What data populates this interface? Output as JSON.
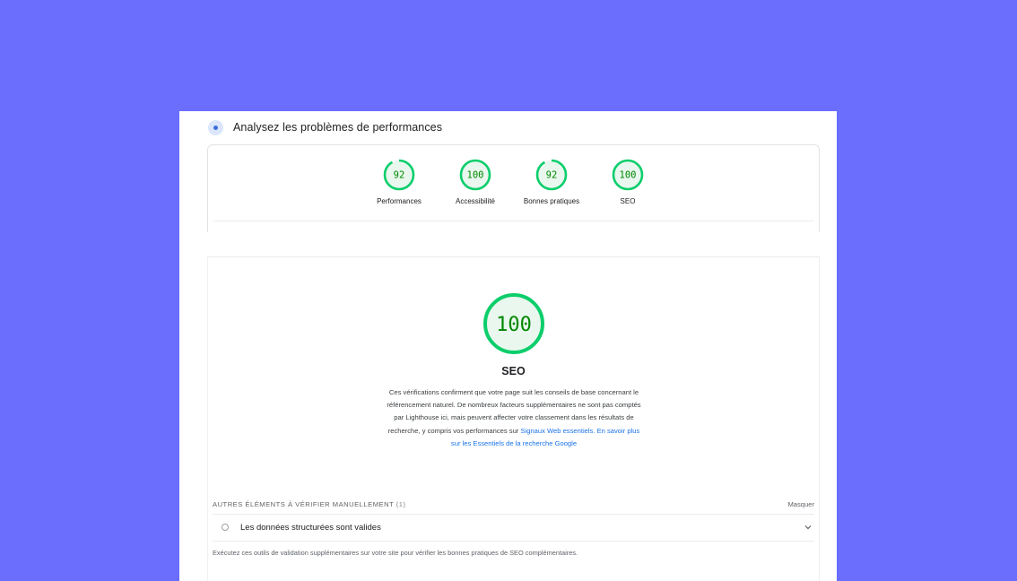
{
  "header": {
    "title": "Analysez les problèmes de performances"
  },
  "summary": {
    "gauges": [
      {
        "score": "92",
        "label": "Performances",
        "fraction": 0.92
      },
      {
        "score": "100",
        "label": "Accessibilité",
        "fraction": 1.0
      },
      {
        "score": "92",
        "label": "Bonnes pratiques",
        "fraction": 0.92
      },
      {
        "score": "100",
        "label": "SEO",
        "fraction": 1.0
      }
    ]
  },
  "detail": {
    "score": "100",
    "fraction": 1.0,
    "title": "SEO",
    "description": "Ces vérifications confirment que votre page suit les conseils de base concernant le référencement naturel. De nombreux facteurs supplémentaires ne sont pas comptés par Lighthouse ici, mais peuvent affecter votre classement dans les résultats de recherche, y compris vos performances sur ",
    "link1": "Signaux Web essentiels",
    "link_sep": ". ",
    "link2": "En savoir plus sur les Essentiels de la recherche Google"
  },
  "manual": {
    "title": "Autres éléments à vérifier manuellement",
    "count": "(1)",
    "hide_label": "Masquer",
    "audit": "Les données structurées sont valides",
    "note": "Exécutez ces outils de validation supplémentaires sur votre site pour vérifier les bonnes pratiques de SEO complémentaires."
  },
  "colors": {
    "background": "#6b6dfd",
    "pass": "#0cce6b",
    "pass_text": "#008800",
    "pass_fill": "#e9f7ee",
    "link": "#1a73e8"
  },
  "icons": {
    "header": "lighthouse-icon",
    "audit_status": "circle-outline-icon",
    "expand": "chevron-down-icon"
  }
}
